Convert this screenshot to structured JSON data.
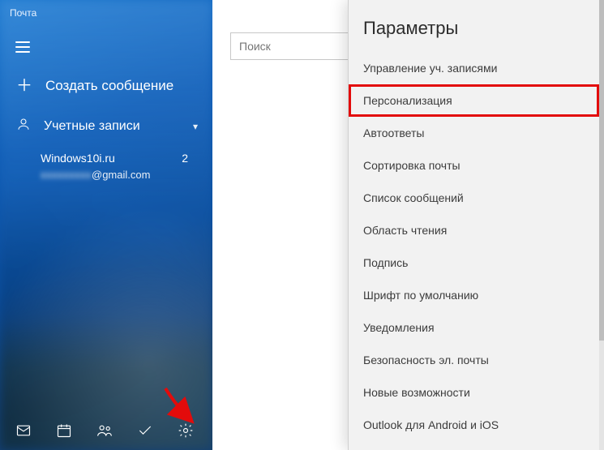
{
  "window": {
    "title": "Почта"
  },
  "sidebar": {
    "compose_label": "Создать сообщение",
    "accounts_header": "Учетные записи",
    "account": {
      "name": "Windows10i.ru",
      "email_suffix": "@gmail.com",
      "unread_count": "2"
    }
  },
  "search": {
    "placeholder": "Поиск"
  },
  "settings": {
    "title": "Параметры",
    "highlight_index": 1,
    "items": [
      "Управление уч. записями",
      "Персонализация",
      "Автоответы",
      "Сортировка почты",
      "Список сообщений",
      "Область чтения",
      "Подпись",
      "Шрифт по умолчанию",
      "Уведомления",
      "Безопасность эл. почты",
      "Новые возможности",
      "Outlook для Android и iOS"
    ]
  },
  "icons": {
    "hamburger": "menu-icon",
    "plus": "plus-icon",
    "person": "person-icon",
    "chevron": "chevron-down-icon",
    "mail": "mail-icon",
    "calendar": "calendar-icon",
    "people": "people-icon",
    "todo": "todo-icon",
    "gear": "gear-icon",
    "minimize": "minimize-icon",
    "maximize": "maximize-icon",
    "close": "close-icon"
  }
}
